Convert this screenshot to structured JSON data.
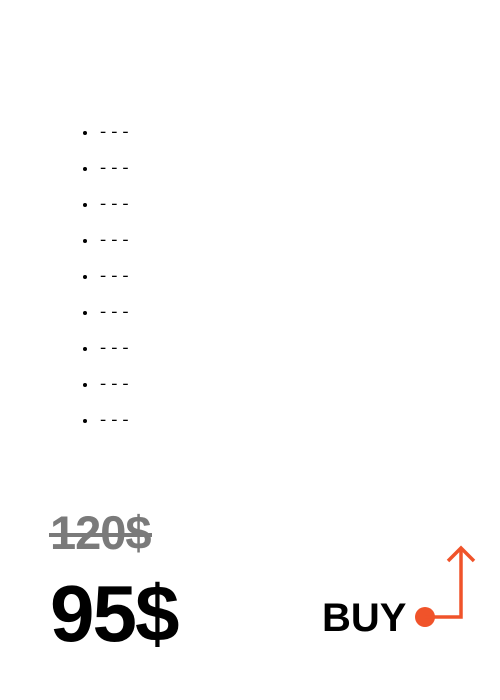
{
  "features": {
    "items": [
      "---",
      "---",
      "---",
      "---",
      "---",
      "---",
      "---",
      "---",
      "---"
    ]
  },
  "pricing": {
    "old_price": "120$",
    "new_price": "95$"
  },
  "buy": {
    "label": "BUY",
    "icon": "arrow-up-icon"
  },
  "colors": {
    "accent": "#f0532a",
    "old_price": "#7a7a7a",
    "text": "#000000",
    "background": "#ffffff"
  }
}
